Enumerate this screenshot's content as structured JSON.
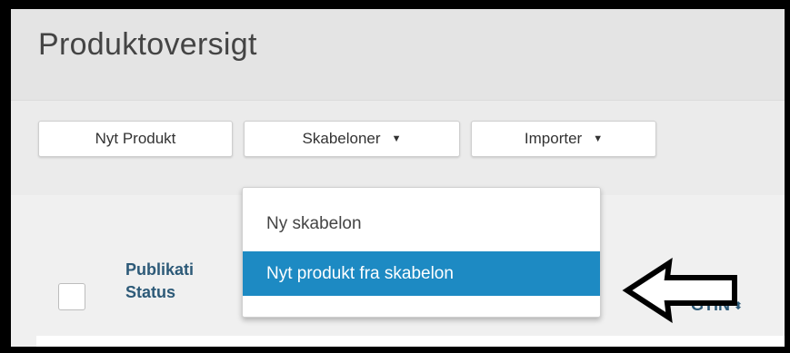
{
  "header": {
    "title": "Produktoversigt"
  },
  "toolbar": {
    "new_product_label": "Nyt Produkt",
    "templates_label": "Skabeloner",
    "import_label": "Importer"
  },
  "dropdown": {
    "items": [
      {
        "label": "Ny skabelon"
      },
      {
        "label": "Nyt produkt fra skabelon",
        "highlighted": true
      }
    ],
    "highlight_color": "#1d8ac3"
  },
  "table": {
    "columns": [
      {
        "label_line1": "Publikati",
        "label_line2": "Status"
      },
      {
        "label": "GTIN",
        "sort_icon": "sort-icon"
      }
    ]
  },
  "annotation": {
    "type": "arrow",
    "points": "left",
    "color": "#000000"
  }
}
